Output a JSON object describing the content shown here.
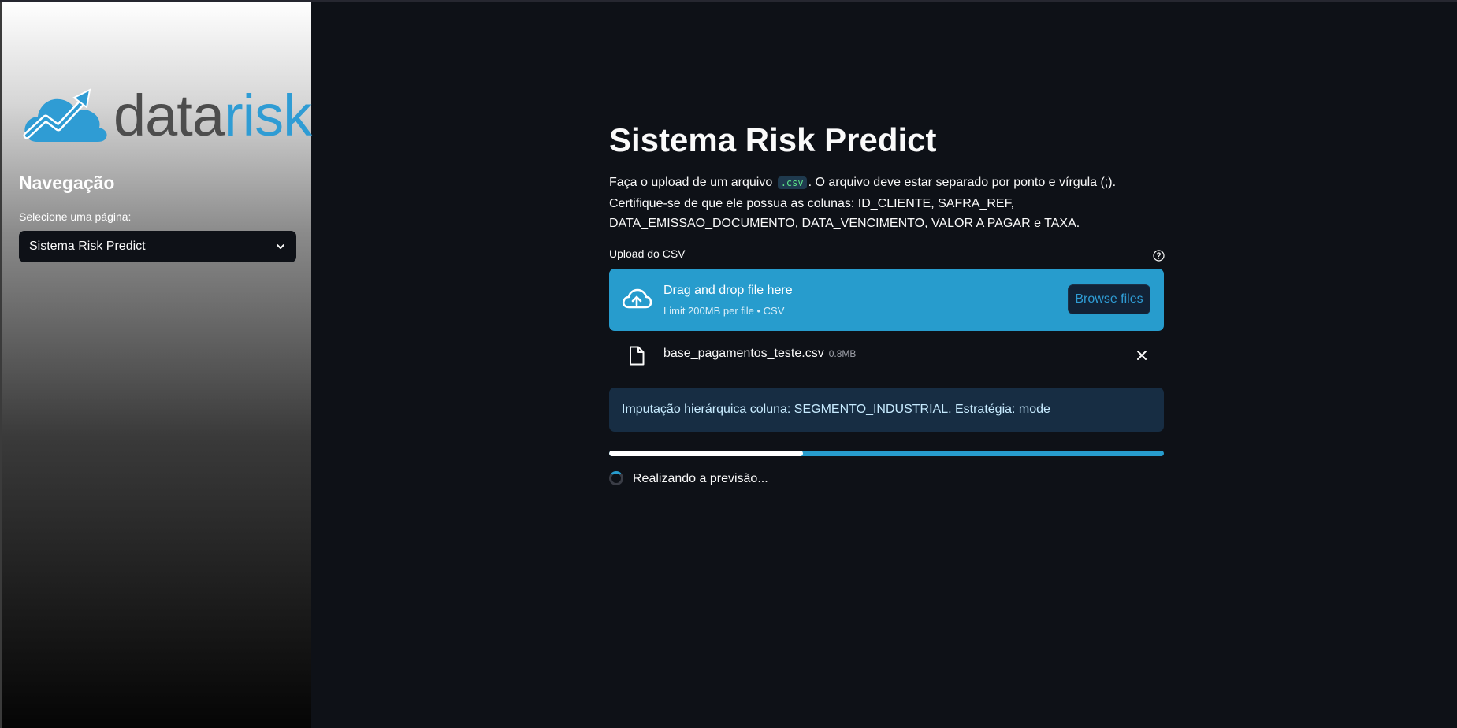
{
  "sidebar": {
    "logo": {
      "part1": "data",
      "part2": "risk"
    },
    "nav_title": "Navegação",
    "select_label": "Selecione uma página:",
    "select_value": "Sistema Risk Predict"
  },
  "main": {
    "title": "Sistema Risk Predict",
    "description": {
      "before_code": "Faça o upload de um arquivo ",
      "code": ".csv",
      "after_code": ". O arquivo deve estar separado por ponto e vírgula (;). Certifique-se de que ele possua as colunas: ID_CLIENTE, SAFRA_REF, DATA_EMISSAO_DOCUMENTO, DATA_VENCIMENTO, VALOR A PAGAR e TAXA."
    },
    "uploader": {
      "label": "Upload do CSV",
      "drop_title": "Drag and drop file here",
      "drop_subtitle": "Limit 200MB per file • CSV",
      "browse_label": "Browse files"
    },
    "file": {
      "name": "base_pagamentos_teste.csv",
      "size": "0.8MB"
    },
    "info_message": "Imputação hierárquica coluna: SEGMENTO_INDUSTRIAL. Estratégia: mode",
    "progress": 0.35,
    "spinner_text": "Realizando a previsão..."
  },
  "colors": {
    "background": "#0e1117",
    "accent": "#279ccd",
    "logo_gray": "#4d4d4d",
    "logo_blue": "#2f9cd4",
    "alert_bg": "#172d43"
  },
  "icons": [
    "chevron-down-icon",
    "help-icon",
    "cloud-upload-icon",
    "file-icon",
    "close-icon",
    "spinner-icon"
  ]
}
